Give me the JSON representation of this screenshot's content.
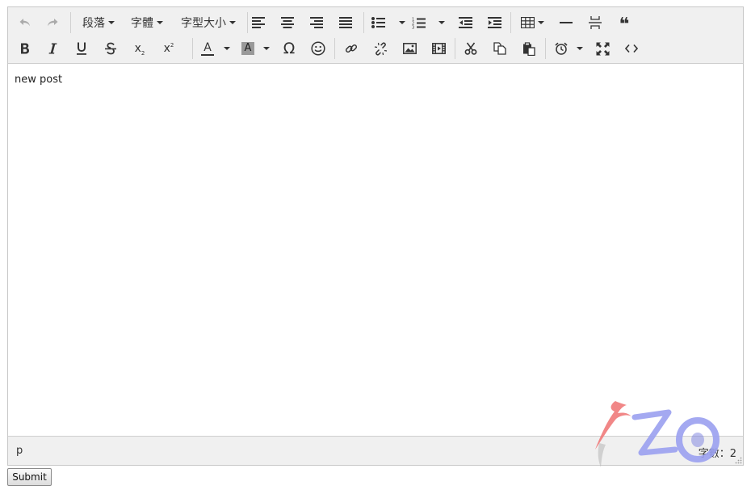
{
  "toolbar": {
    "paragraph_label": "段落",
    "font_label": "字體",
    "font_size_label": "字型大小",
    "omega_glyph": "Ω",
    "quote_glyph": "❝",
    "superscript_x": "x",
    "superscript_2": "2",
    "subscript_x": "x",
    "subscript_2": "2",
    "font_color_letter": "A",
    "bg_color_letter": "A",
    "colors": {
      "font_color": "#333333",
      "bg_color": "#999999"
    }
  },
  "content": {
    "text": "new post"
  },
  "statusbar": {
    "path": "p",
    "word_count_label": "字數：2"
  },
  "form": {
    "submit_label": "Submit"
  },
  "logo": {
    "text": "ZO"
  }
}
